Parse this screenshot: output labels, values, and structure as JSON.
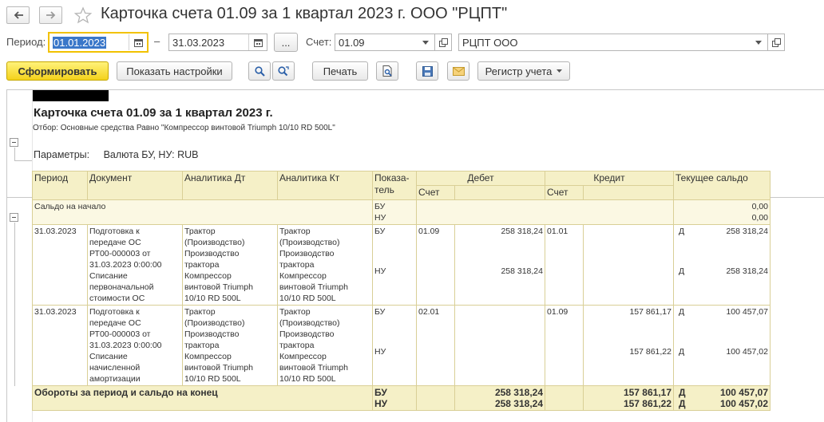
{
  "window": {
    "title": "Карточка счета 01.09 за 1 квартал 2023 г. ООО \"РЦПТ\""
  },
  "form": {
    "period_label": "Период:",
    "date_from": "01.01.2023",
    "dash": "–",
    "date_to": "31.03.2023",
    "dots_label": "...",
    "account_label": "Счет:",
    "account_value": "01.09",
    "org_value": "РЦПТ ООО"
  },
  "toolbar": {
    "generate": "Сформировать",
    "show_settings": "Показать настройки",
    "print": "Печать",
    "register": "Регистр учета"
  },
  "report": {
    "title": "Карточка счета 01.09 за 1 квартал 2023 г.",
    "filter": "Отбор: Основные средства Равно \"Компрессор винтовой Triumph 10/10 RD 500L\"",
    "params_label": "Параметры:",
    "params_value": "Валюта БУ, НУ: RUB",
    "headers": {
      "period": "Период",
      "document": "Документ",
      "an_dt": "Аналитика Дт",
      "an_kt": "Аналитика Кт",
      "indicator_1": "Показа-",
      "indicator_2": "тель",
      "debit": "Дебет",
      "credit": "Кредит",
      "balance": "Текущее сальдо",
      "acc_debit": "Счет",
      "acc_credit": "Счет"
    },
    "opening": {
      "label": "Сальдо на начало",
      "ind1": "БУ",
      "ind2": "НУ",
      "val1": "0,00",
      "val2": "0,00"
    },
    "rows": [
      {
        "date": "31.03.2023",
        "doc": [
          "Подготовка к",
          "передаче ОС",
          "РТ00-000003 от",
          "31.03.2023 0:00:00",
          "Списание",
          "первоначальной",
          "стоимости ОС"
        ],
        "an_dt": [
          "Трактор",
          "(Производство)",
          "Производство",
          "трактора",
          "Компрессор",
          "винтовой Triumph",
          "10/10 RD 500L"
        ],
        "an_kt": [
          "Трактор",
          "(Производство)",
          "Производство",
          "трактора",
          "Компрессор",
          "винтовой Triumph",
          "10/10 RD 500L"
        ],
        "ind1": "БУ",
        "ind2": "НУ",
        "debit_acc": "01.09",
        "debit1": "258 318,24",
        "debit2": "258 318,24",
        "credit_acc": "01.01",
        "credit1": "",
        "credit2": "",
        "bal_dir1": "Д",
        "bal1": "258 318,24",
        "bal_dir2": "Д",
        "bal2": "258 318,24"
      },
      {
        "date": "31.03.2023",
        "doc": [
          "Подготовка к",
          "передаче ОС",
          "РТ00-000003 от",
          "31.03.2023 0:00:00",
          "Списание",
          "начисленной",
          "амортизации"
        ],
        "an_dt": [
          "Трактор",
          "(Производство)",
          "Производство",
          "трактора",
          "Компрессор",
          "винтовой Triumph",
          "10/10 RD 500L"
        ],
        "an_kt": [
          "Трактор",
          "(Производство)",
          "Производство",
          "трактора",
          "Компрессор",
          "винтовой Triumph",
          "10/10 RD 500L"
        ],
        "ind1": "БУ",
        "ind2": "НУ",
        "debit_acc": "02.01",
        "debit1": "",
        "debit2": "",
        "credit_acc": "01.09",
        "credit1": "157 861,17",
        "credit2": "157 861,22",
        "bal_dir1": "Д",
        "bal1": "100 457,07",
        "bal_dir2": "Д",
        "bal2": "100 457,02"
      }
    ],
    "totals": {
      "label": "Обороты за период и сальдо на конец",
      "ind1": "БУ",
      "ind2": "НУ",
      "debit1": "258 318,24",
      "debit2": "258 318,24",
      "credit1": "157 861,17",
      "credit2": "157 861,22",
      "dir1": "Д",
      "dir2": "Д",
      "bal1": "100 457,07",
      "bal2": "100 457,02"
    }
  },
  "icons": [
    "back-arrow-icon",
    "forward-arrow-icon",
    "favorite-star-icon",
    "calendar-icon",
    "dropdown-arrow-icon",
    "open-link-icon",
    "search-icon",
    "search-advanced-icon",
    "print-preview-icon",
    "save-disk-icon",
    "email-envelope-icon",
    "tree-collapse-icon"
  ],
  "colors": {
    "primary_button": "#f4d21c",
    "header_fill": "#f5f0c7",
    "grid_line": "#d9cf96",
    "focus_border": "#f2c200",
    "selection": "#3a77c9"
  }
}
